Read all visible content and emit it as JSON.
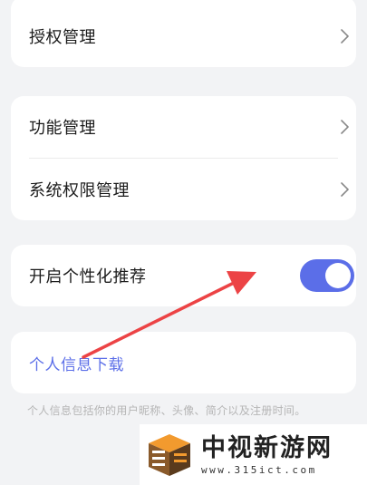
{
  "settings": {
    "authorization": {
      "label": "授权管理"
    },
    "features": {
      "label": "功能管理"
    },
    "system_permissions": {
      "label": "系统权限管理"
    },
    "personalized_recommendation": {
      "label": "开启个性化推荐",
      "enabled": true
    },
    "personal_info_download": {
      "label": "个人信息下载"
    },
    "footnote": "个人信息包括你的用户昵称、头像、简介以及注册时间。"
  },
  "colors": {
    "accent": "#5b6ee8",
    "annotation_arrow": "#ec4345",
    "background": "#f2f3f5"
  },
  "icons": {
    "row_chevron": "chevron-right-icon",
    "logo": "site-logo-icon"
  },
  "watermark": {
    "title": "中视新游网",
    "url": "www.315ict.com"
  }
}
